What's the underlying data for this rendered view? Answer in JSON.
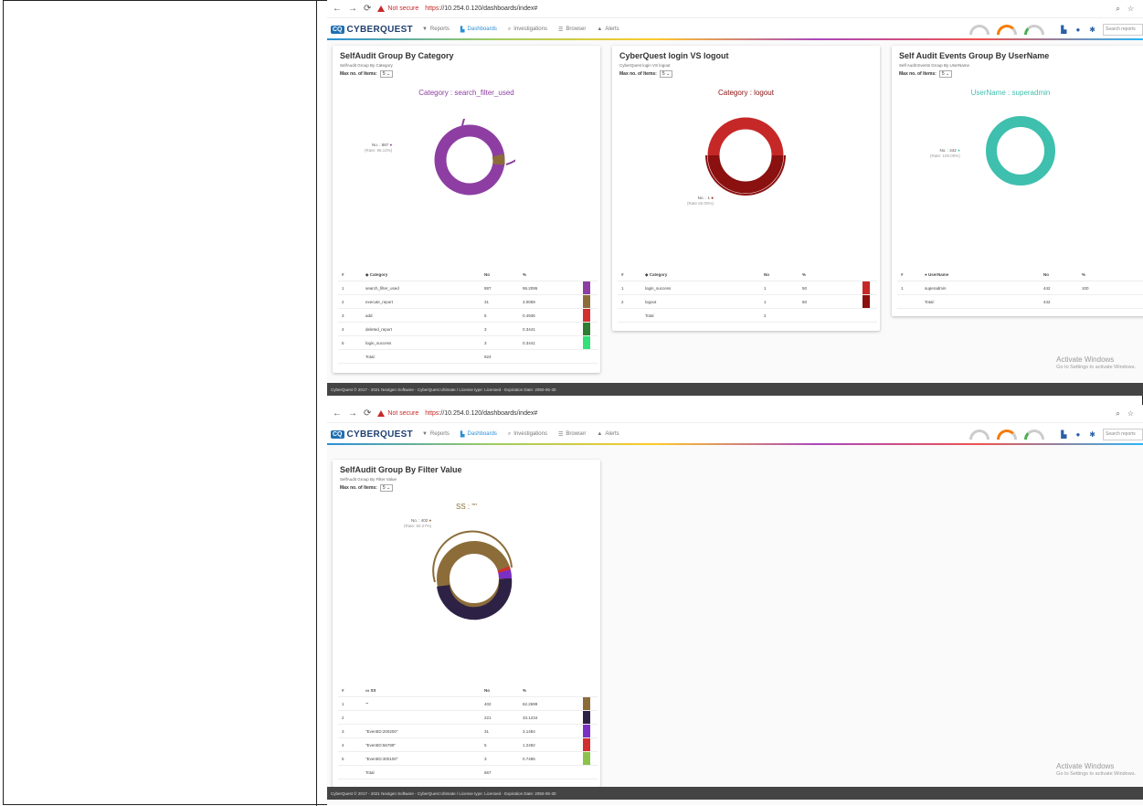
{
  "browser": {
    "not_secure": "Not secure",
    "url_https": "https",
    "url_rest": "://10.254.0.120/dashboards/index#"
  },
  "app": {
    "brand_box": "CQ",
    "brand": "CYBERQUEST",
    "nav": [
      "Reports",
      "Dashboards",
      "Investigations",
      "Browser",
      "Alerts"
    ],
    "search_placeholder": "Search reports"
  },
  "cards": {
    "category": {
      "title": "SelfAudit Group By Category",
      "subtitle": "SelfAudit Group By Category",
      "max_label": "Max no. of Items:",
      "max_value": "5",
      "caption": "Category : search_filter_used",
      "caption_color": "#8e3ea3",
      "callout_no": "No. : 887",
      "callout_rate": "(Rate: 96.13%)",
      "headers": [
        "#",
        "Category",
        "No",
        "%"
      ],
      "rows": [
        {
          "n": "1",
          "name": "search_filter_used",
          "no": "887",
          "pct": "96.2095",
          "color": "#8e3ea3"
        },
        {
          "n": "2",
          "name": "execute_report",
          "no": "31",
          "pct": "3.0059",
          "color": "#8c6d3a"
        },
        {
          "n": "3",
          "name": "add",
          "no": "5",
          "pct": "0.4936",
          "color": "#d32f2f"
        },
        {
          "n": "4",
          "name": "deleted_report",
          "no": "3",
          "pct": "0.3441",
          "color": "#2e7d32"
        },
        {
          "n": "5",
          "name": "login_success",
          "no": "3",
          "pct": "0.3441",
          "color": "#33e07a"
        }
      ],
      "total_label": "Total:",
      "total": "924"
    },
    "login": {
      "title": "CyberQuest login VS logout",
      "subtitle": "CyberQuest login VS logout",
      "max_label": "Max no. of Items:",
      "max_value": "5",
      "caption": "Category : logout",
      "caption_color": "#8b1010",
      "callout_no": "No. : 1",
      "callout_rate": "(Rate 50.00%)",
      "headers": [
        "#",
        "Category",
        "No",
        "%"
      ],
      "rows": [
        {
          "n": "1",
          "name": "login_success",
          "no": "1",
          "pct": "50",
          "color": "#c62828"
        },
        {
          "n": "2",
          "name": "logout",
          "no": "1",
          "pct": "50",
          "color": "#8b1010"
        }
      ],
      "total_label": "Total",
      "total": "2"
    },
    "user": {
      "title": "Self Audit Events Group By UserName",
      "subtitle": "Self Audit Events Group By UserName",
      "max_label": "Max no. of Items:",
      "max_value": "5",
      "caption": "UserName : superadmin",
      "caption_color": "#3fbfae",
      "callout_no": "No. : 442",
      "callout_rate": "(Rate: 100.00%)",
      "headers": [
        "#",
        "UserName",
        "No",
        "%"
      ],
      "rows": [
        {
          "n": "1",
          "name": "superadmin",
          "no": "442",
          "pct": "100",
          "color": "#3fbfae"
        }
      ],
      "total_label": "Total:",
      "total": "442"
    },
    "filter": {
      "title": "SelfAudit Group By Filter Value",
      "subtitle": "SelfAudit Group By Filter Value",
      "max_label": "Max no. of Items:",
      "max_value": "5",
      "caption": "SS : \"\"",
      "caption_color": "#8c6d3a",
      "callout_no": "No. : 402",
      "callout_rate": "(Rate: 60.27%)",
      "headers": [
        "#",
        "SS",
        "No",
        "%"
      ],
      "rows": [
        {
          "n": "1",
          "name": "\"\"",
          "no": "402",
          "pct": "62.2699",
          "color": "#8c6d3a"
        },
        {
          "n": "2",
          "name": "",
          "no": "221",
          "pct": "33.1234",
          "color": "#2d2245"
        },
        {
          "n": "3",
          "name": "\"EventID:200200\"",
          "no": "31",
          "pct": "3.1484",
          "color": "#7b2fc7"
        },
        {
          "n": "4",
          "name": "\"EventID:56789\"",
          "no": "5",
          "pct": "1.2492",
          "color": "#d32f2f"
        },
        {
          "n": "5",
          "name": "\"EventID:300100\"",
          "no": "3",
          "pct": "0.7495",
          "color": "#8bc34a"
        }
      ],
      "total_label": "Total",
      "total": "667"
    }
  },
  "footer1": "CyberQuest © 2017 - 2021 Nextgen Software - CyberQuest Ultimate / License type: Licensed - Expiration Date: 2050-06-30",
  "footer2": "CyberQuest © 2017 - 2021 Nextgen Software - CyberQuest Ultimate / License type: Licensed - Expiration Date: 2050-06-30",
  "activate": {
    "title": "Activate Windows",
    "sub": "Go to Settings to activate Windows."
  }
}
